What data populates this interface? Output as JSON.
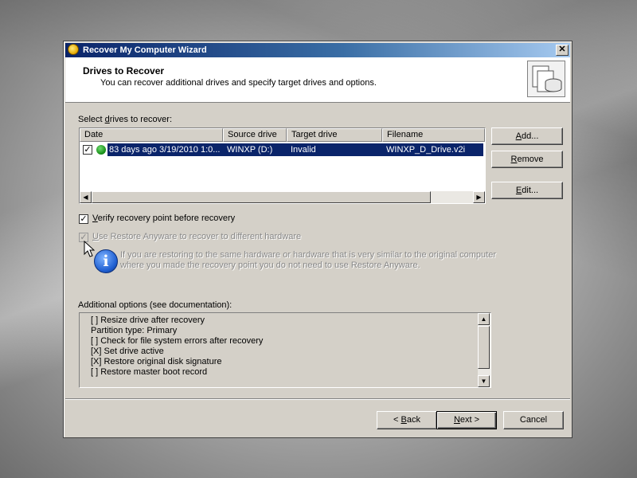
{
  "window": {
    "title": "Recover My Computer Wizard",
    "close_glyph": "✕"
  },
  "header": {
    "title": "Drives to Recover",
    "subtitle": "You can recover additional drives and specify target drives and options."
  },
  "drives": {
    "label_pre": "Select ",
    "label_u": "d",
    "label_post": "rives to recover:",
    "columns": [
      "Date",
      "Source drive",
      "Target drive",
      "Filename"
    ],
    "rows": [
      {
        "checked": "✓",
        "date": "83 days ago 3/19/2010 1:0...",
        "source": "WINXP (D:)",
        "target": "Invalid",
        "filename": "WINXP_D_Drive.v2i"
      }
    ],
    "scroll_left": "◀",
    "scroll_right": "▶"
  },
  "buttons": {
    "add_pre": "",
    "add_u": "A",
    "add_post": "dd...",
    "remove_pre": "",
    "remove_u": "R",
    "remove_post": "emove",
    "edit_pre": "",
    "edit_u": "E",
    "edit_post": "dit...",
    "back_pre": "< ",
    "back_u": "B",
    "back_post": "ack",
    "next_pre": "",
    "next_u": "N",
    "next_post": "ext >",
    "cancel": "Cancel"
  },
  "options": {
    "verify": {
      "checked": "✓",
      "u": "V",
      "rest": "erify recovery point before recovery"
    },
    "restore_anyware": {
      "checked": "✓",
      "u": "U",
      "rest": "se Restore Anyware to recover to different hardware"
    },
    "info_glyph": "i",
    "info_line1": "If you are restoring to the same hardware or hardware that is very similar to the original computer",
    "info_line2": "where you made the recovery point you do not need to use Restore Anyware."
  },
  "additional": {
    "label": "Additional options (see documentation):",
    "lines": [
      "[ ] Resize drive after recovery",
      "Partition type:  Primary",
      "[ ] Check for file system errors after recovery",
      "[X] Set drive active",
      "[X] Restore original disk signature",
      "[ ] Restore master boot record"
    ],
    "scroll_up": "▲",
    "scroll_down": "▼"
  }
}
